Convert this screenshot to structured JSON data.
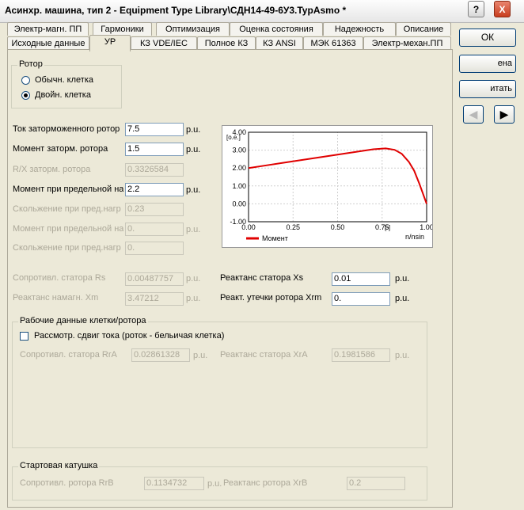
{
  "window": {
    "title": "Асинхр. машина, тип 2 - Equipment Type Library\\СДН14-49-6У3.TypAsmo *",
    "help_label": "?",
    "close_label": "X"
  },
  "tabs_row1": [
    "Электр-магн. ПП",
    "Гармоники",
    "Оптимизация",
    "Оценка состояния",
    "Надежность",
    "Описание"
  ],
  "tabs_row2": [
    "Исходные данные",
    "УР",
    "КЗ VDE/IEC",
    "Полное КЗ",
    "КЗ ANSI",
    "МЭК 61363",
    "Электр-механ.ПП"
  ],
  "buttons": {
    "ok": "ОК",
    "cancel_partial": "ена",
    "calc_partial": "итать",
    "prev_icon": "◀",
    "next_icon": "▶"
  },
  "rotor": {
    "title": "Ротор",
    "options": [
      "Обычн. клетка",
      "Двойн. клетка"
    ],
    "selected": 1
  },
  "fields": [
    {
      "label": "Ток заторможенного ротор",
      "value": "7.5",
      "unit": "p.u.",
      "enabled": true
    },
    {
      "label": "Момент заторм. ротора",
      "value": "1.5",
      "unit": "p.u.",
      "enabled": true
    },
    {
      "label": "R/X заторм. ротора",
      "value": "0.3326584",
      "unit": "",
      "enabled": false
    },
    {
      "label": "Момент при предельной на",
      "value": "2.2",
      "unit": "p.u.",
      "enabled": true
    },
    {
      "label": "Скольжение при пред.нагр",
      "value": "0.23",
      "unit": "",
      "enabled": false
    },
    {
      "label": "Момент при предельной на",
      "value": "0.",
      "unit": "p.u.",
      "enabled": false
    },
    {
      "label": "Скольжение при пред.нагр",
      "value": "0.",
      "unit": "",
      "enabled": false
    }
  ],
  "stator": {
    "rs_label": "Сопротивл. статора Rs",
    "rs_value": "0.00487757",
    "rs_unit": "p.u.",
    "xm_label": "Реактанс намагн. Xm",
    "xm_value": "3.47212",
    "xm_unit": "p.u.",
    "xs_label": "Реактанс статора Xs",
    "xs_value": "0.01",
    "xs_unit": "p.u.",
    "xrm_label": "Реакт. утечки ротора Xrm",
    "xrm_value": "0.",
    "xrm_unit": "p.u."
  },
  "cage": {
    "title": "Рабочие данные клетки/ротора",
    "check_label": "Рассмотр. сдвиг тока (роток - бельичая клетка)",
    "rra_label": "Сопротивл. статора RrA",
    "rra_value": "0.02861328",
    "rra_unit": "p.u.",
    "xra_label": "Реактанс статора XrA",
    "xra_value": "0.1981586",
    "xra_unit": "p.u."
  },
  "starting": {
    "title": "Стартовая катушка",
    "rrb_label": "Сопротивл. ротора RrB",
    "rrb_value": "0.1134732",
    "rrb_unit": "p.u.",
    "xrb_label": "Реактанс ротора XrB",
    "xrb_value": "0.2"
  },
  "chart_data": {
    "type": "line",
    "ylabel": "[о.е.]",
    "xlabel": "n/nsin",
    "xunit": "[-]",
    "xlim": [
      0,
      1
    ],
    "ylim": [
      -1,
      4
    ],
    "xticks": [
      "0.00",
      "0.25",
      "0.50",
      "0.75",
      "1.00"
    ],
    "yticks": [
      "4.00",
      "3.00",
      "2.00",
      "1.00",
      "0.00",
      "-1.00"
    ],
    "legend": "Момент",
    "series_color": "#e00000",
    "series": [
      {
        "name": "Момент",
        "x": [
          0,
          0.1,
          0.2,
          0.3,
          0.4,
          0.5,
          0.6,
          0.7,
          0.77,
          0.82,
          0.86,
          0.9,
          0.93,
          0.96,
          0.98,
          1.0
        ],
        "y": [
          2.0,
          2.15,
          2.3,
          2.45,
          2.6,
          2.75,
          2.9,
          3.05,
          3.1,
          3.02,
          2.8,
          2.35,
          1.85,
          1.1,
          0.55,
          0.0
        ]
      }
    ]
  }
}
